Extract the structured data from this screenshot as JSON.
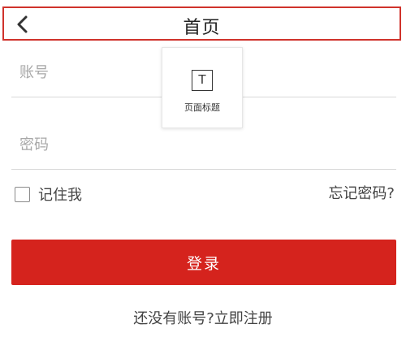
{
  "header": {
    "title": "首页",
    "back_icon": "chevron-left-icon",
    "border_color": "#d0332c"
  },
  "form": {
    "account": {
      "value": "",
      "placeholder": "账号"
    },
    "password": {
      "value": "",
      "placeholder": "密码"
    },
    "remember_label": "记住我",
    "remember_checked": false,
    "forgot_label": "忘记密码?"
  },
  "login": {
    "label": "登录",
    "color": "#d5231d"
  },
  "register": {
    "prompt": "还没有账号?",
    "link": "立即注册"
  },
  "component_tip": {
    "icon_glyph": "T",
    "label": "页面标题"
  }
}
